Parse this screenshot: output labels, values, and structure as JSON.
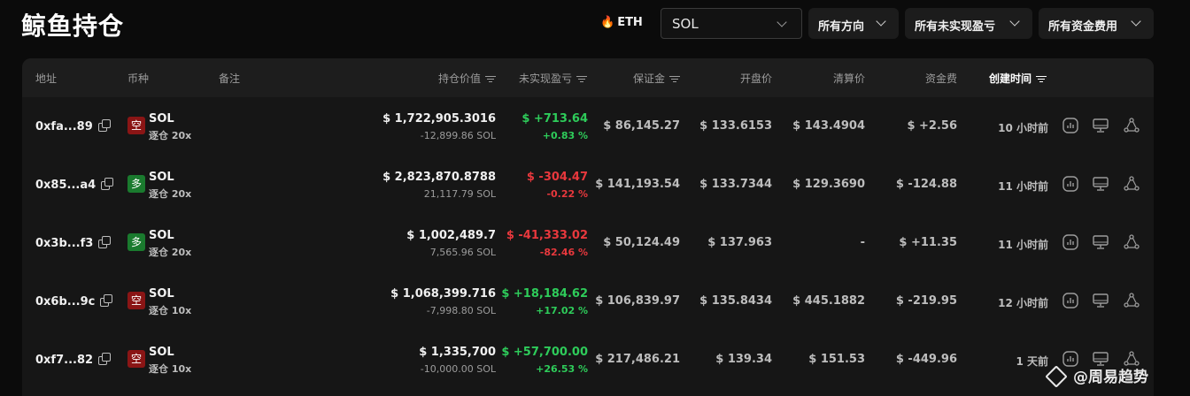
{
  "page": {
    "title": "鲸鱼持仓",
    "eth_tab": "ETH",
    "symbol_select": "SOL",
    "filters": [
      "所有方向",
      "所有未实现盈亏",
      "所有资金费用"
    ],
    "watermark": "@周易趋势"
  },
  "columns": {
    "address": "地址",
    "coin": "币种",
    "note": "备注",
    "value": "持仓价值",
    "pnl": "未实现盈亏",
    "margin": "保证金",
    "open": "开盘价",
    "liq": "清算价",
    "funding": "资金费",
    "created": "创建时间"
  },
  "rows": [
    {
      "address": "0xfa...89",
      "dir": "空",
      "dir_type": "short",
      "coin": "SOL",
      "mode": "逐仓 20x",
      "value": "$ 1,722,905.3016",
      "size": "-12,899.86 SOL",
      "pnl": "$ +713.64",
      "pnl_pct": "+0.83 %",
      "pnl_sign": "green",
      "margin": "$ 86,145.27",
      "open": "$ 133.6153",
      "liq": "$ 143.4904",
      "funding": "$ +2.56",
      "funding_sign": "green",
      "created": "10 小时前"
    },
    {
      "address": "0x85...a4",
      "dir": "多",
      "dir_type": "long",
      "coin": "SOL",
      "mode": "逐仓 20x",
      "value": "$ 2,823,870.8788",
      "size": "21,117.79 SOL",
      "pnl": "$ -304.47",
      "pnl_pct": "-0.22 %",
      "pnl_sign": "red",
      "margin": "$ 141,193.54",
      "open": "$ 133.7344",
      "liq": "$ 129.3690",
      "funding": "$ -124.88",
      "funding_sign": "red",
      "created": "11 小时前"
    },
    {
      "address": "0x3b...f3",
      "dir": "多",
      "dir_type": "long",
      "coin": "SOL",
      "mode": "逐仓 20x",
      "value": "$ 1,002,489.7",
      "size": "7,565.96 SOL",
      "pnl": "$ -41,333.02",
      "pnl_pct": "-82.46 %",
      "pnl_sign": "red",
      "margin": "$ 50,124.49",
      "open": "$ 137.963",
      "liq": "-",
      "funding": "$ +11.35",
      "funding_sign": "green",
      "created": "11 小时前"
    },
    {
      "address": "0x6b...9c",
      "dir": "空",
      "dir_type": "short",
      "coin": "SOL",
      "mode": "逐仓 10x",
      "value": "$ 1,068,399.716",
      "size": "-7,998.80 SOL",
      "pnl": "$ +18,184.62",
      "pnl_pct": "+17.02 %",
      "pnl_sign": "green",
      "margin": "$ 106,839.97",
      "open": "$ 135.8434",
      "liq": "$ 445.1882",
      "funding": "$ -219.95",
      "funding_sign": "red",
      "created": "12 小时前"
    },
    {
      "address": "0xf7...82",
      "dir": "空",
      "dir_type": "short",
      "coin": "SOL",
      "mode": "逐仓 10x",
      "value": "$ 1,335,700",
      "size": "-10,000.00 SOL",
      "pnl": "$ +57,700.00",
      "pnl_pct": "+26.53 %",
      "pnl_sign": "green",
      "margin": "$ 217,486.21",
      "open": "$ 139.34",
      "liq": "$ 151.53",
      "funding": "$ -449.96",
      "funding_sign": "red",
      "created": "1 天前"
    }
  ],
  "colors": {
    "profit": "#2ecc5a",
    "loss": "#e8383d",
    "long_badge": "#1a7a2e",
    "short_badge": "#8a1515",
    "eth_icon": "#ff7a1a"
  },
  "icons": {
    "eth": "fire-icon",
    "actions": [
      "chart-icon",
      "monitor-icon",
      "share-icon"
    ]
  }
}
